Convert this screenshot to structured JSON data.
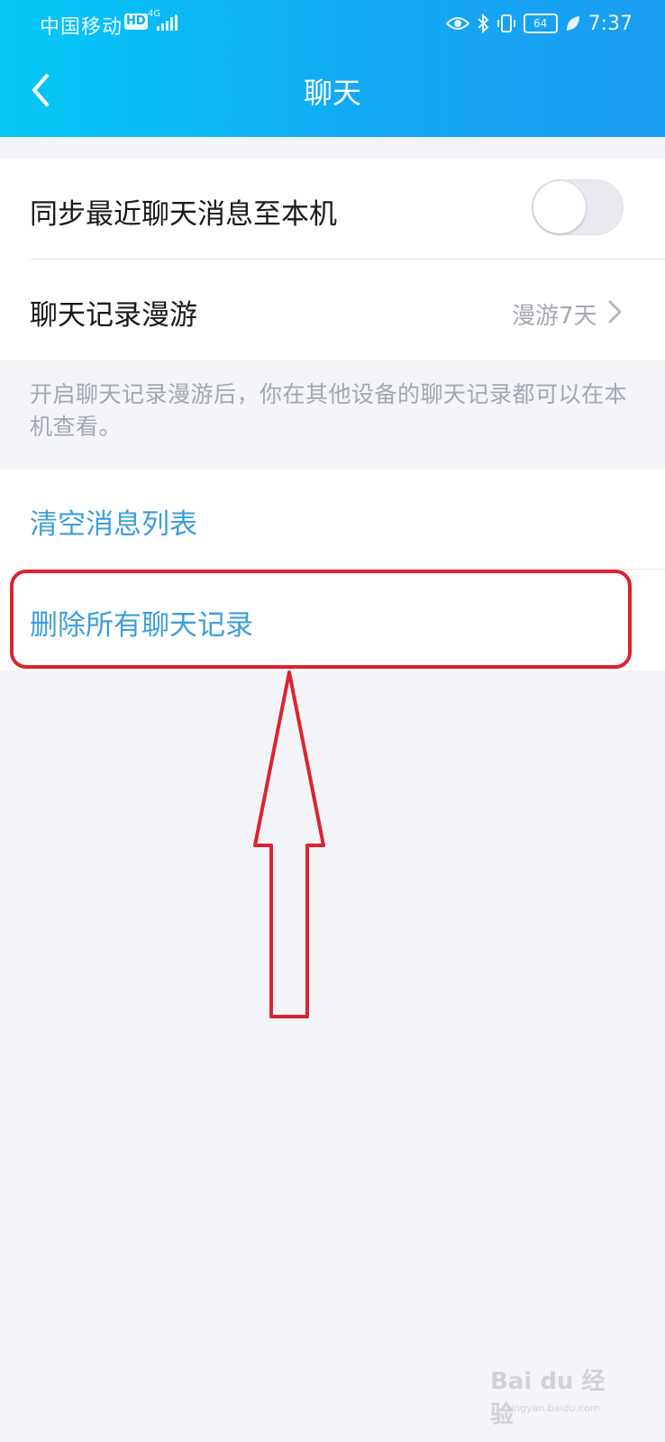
{
  "status_bar": {
    "carrier": "中国移动",
    "hd_badge": "HD",
    "network": "4G",
    "battery": "64",
    "time": "7:37"
  },
  "header": {
    "title": "聊天",
    "back_icon": "chevron-left-icon"
  },
  "settings": {
    "sync_label": "同步最近聊天消息至本机",
    "sync_enabled": false,
    "roaming_label": "聊天记录漫游",
    "roaming_value": "漫游7天",
    "roaming_hint": "开启聊天记录漫游后，你在其他设备的聊天记录都可以在本机查看。",
    "clear_list_label": "清空消息列表",
    "delete_all_label": "删除所有聊天记录"
  },
  "colors": {
    "header_gradient_start": "#05c8f6",
    "header_gradient_end": "#1c9cf2",
    "action_text": "#3d9fdc",
    "annotation": "#dd2330",
    "page_background": "#f4f5f9"
  },
  "watermark": {
    "brand": "Bai du 经验",
    "domain": "jingyan.baidu.com"
  }
}
